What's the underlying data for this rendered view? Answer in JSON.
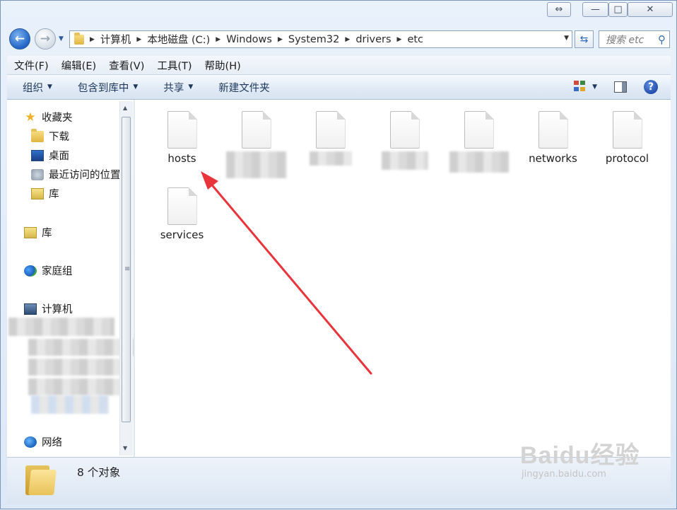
{
  "window": {
    "restore_glyph": "⇔",
    "minimize_glyph": "—",
    "maximize_glyph": "□",
    "close_glyph": "✕"
  },
  "address_bar": {
    "crumbs": [
      "计算机",
      "本地磁盘 (C:)",
      "Windows",
      "System32",
      "drivers",
      "etc"
    ],
    "search_placeholder": "搜索 etc"
  },
  "menu": [
    "文件(F)",
    "编辑(E)",
    "查看(V)",
    "工具(T)",
    "帮助(H)"
  ],
  "toolbar": {
    "organize": "组织",
    "include_in_library": "包含到库中",
    "share": "共享",
    "new_folder": "新建文件夹"
  },
  "nav": {
    "favorites": "收藏夹",
    "downloads": "下载",
    "desktop": "桌面",
    "recent": "最近访问的位置",
    "library_fav": "库",
    "libraries": "库",
    "homegroup": "家庭组",
    "computer": "计算机",
    "network": "网络"
  },
  "files": [
    {
      "name": "hosts",
      "blurred": false
    },
    {
      "name": "",
      "blurred": true
    },
    {
      "name": "",
      "blurred": true
    },
    {
      "name": "",
      "blurred": true
    },
    {
      "name": "",
      "blurred": true
    },
    {
      "name": "networks",
      "blurred": false
    },
    {
      "name": "protocol",
      "blurred": false
    },
    {
      "name": "services",
      "blurred": false
    }
  ],
  "status": {
    "item_count": "8 个对象"
  },
  "watermark": {
    "logo": "Baidu经验",
    "url": "jingyan.baidu.com"
  },
  "colors": {
    "annotation_arrow": "#e8343a"
  }
}
